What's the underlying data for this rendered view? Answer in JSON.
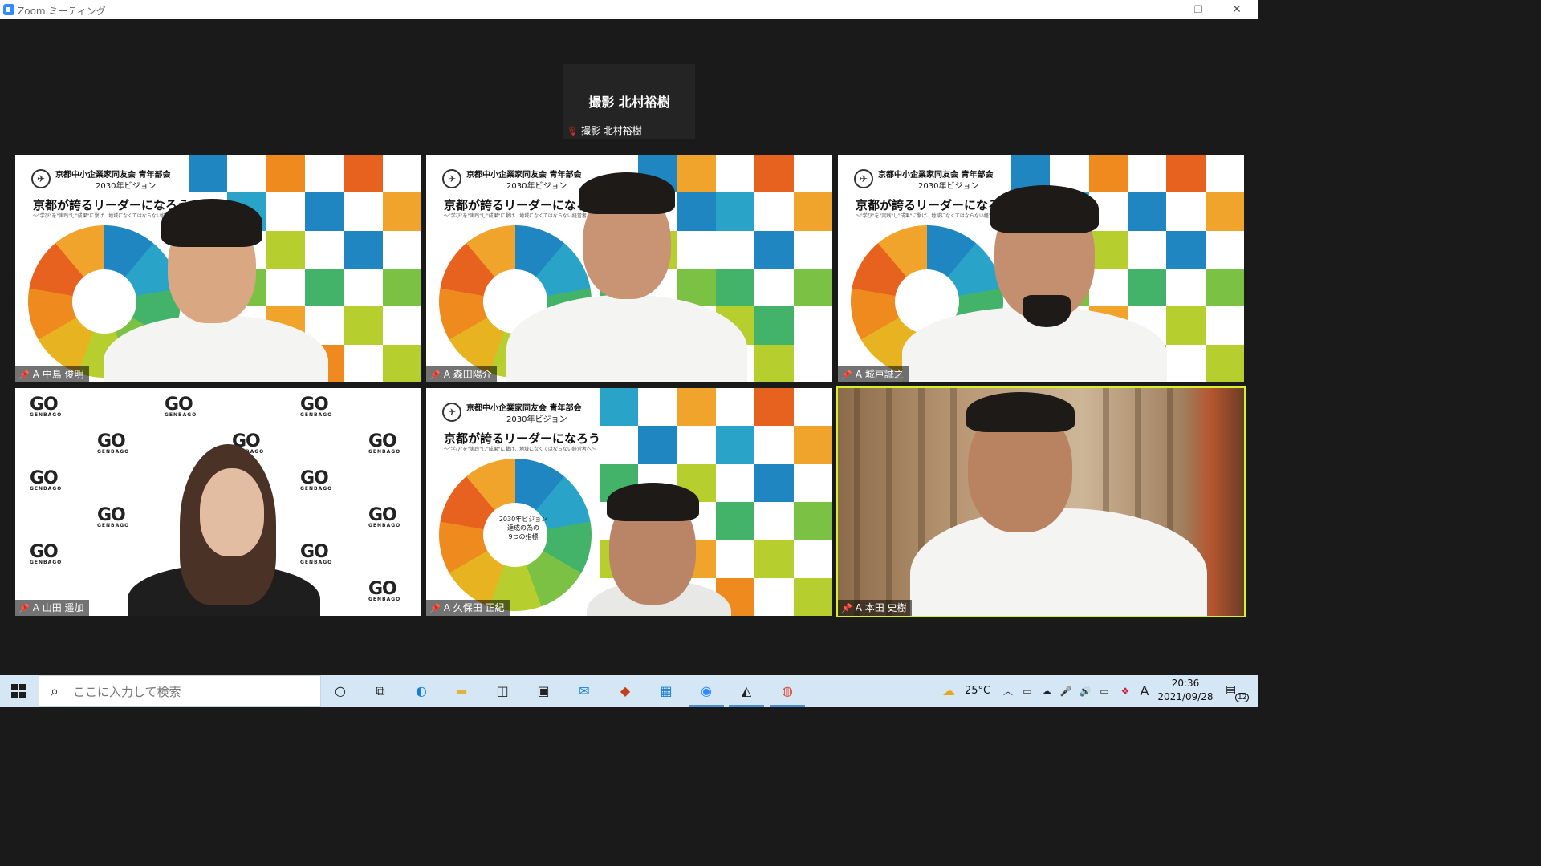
{
  "window": {
    "title": "Zoom ミーティング",
    "minimize": "—",
    "maximize": "❐",
    "close": "✕"
  },
  "speaker": {
    "display_name": "撮影 北村裕樹",
    "footer_name": "撮影 北村裕樹"
  },
  "slide": {
    "org": "京都中小企業家同友会 青年部会",
    "vision": "2030年ビジョン",
    "headline": "京都が誇るリーダーになろう",
    "subline": "〜\"学び\"を\"実践\"し\"成果\"に繋げ、地域になくてはならない経営者へ〜",
    "wheel_center": [
      "2030年ビジョン",
      "達成の為の",
      "9つの指標"
    ]
  },
  "participants": [
    {
      "name": "A 中島 俊明"
    },
    {
      "name": "A 森田陽介"
    },
    {
      "name": "A 城戸誠之"
    },
    {
      "name": "A 山田 遥加"
    },
    {
      "name": "A 久保田 正紀"
    },
    {
      "name": "A 本田 史樹"
    }
  ],
  "backdrop": {
    "logo": "GO",
    "logo_sub": "GENBAGO"
  },
  "taskbar": {
    "search_placeholder": "ここに入力して検索",
    "weather": "25°C",
    "ime": "A",
    "time": "20:36",
    "date": "2021/09/28",
    "notifications": "12",
    "apps": [
      "task-view-icon",
      "edge-icon",
      "file-explorer-icon",
      "store-icon",
      "photos-icon",
      "mail-icon",
      "powerpoint-icon",
      "calendar-icon",
      "zoom-icon",
      "camera-app-icon",
      "chrome-icon"
    ]
  },
  "colors": {
    "active_speaker_border": "#d7f02a",
    "background": "#1a1a1a",
    "taskbar": "#d5e6f4"
  }
}
